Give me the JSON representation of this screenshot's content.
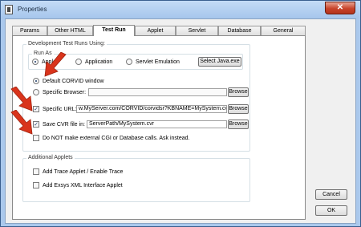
{
  "window": {
    "title": "Properties",
    "close_glyph": "✕"
  },
  "tabs": [
    "Params",
    "Other HTML",
    "Test Run",
    "Applet",
    "Servlet",
    "Database",
    "General"
  ],
  "active_tab": "Test Run",
  "dev_group": {
    "title": "Development Test Runs Using:"
  },
  "run_as": {
    "title": "Run As",
    "applet": "Applet",
    "application": "Application",
    "servlet": "Servlet Emulation",
    "select_java": "Select Java.exe"
  },
  "default_corvid": "Default CORVID window",
  "specific_browser": {
    "label": "Specific Browser:",
    "browse": "Browse"
  },
  "specific_url": {
    "label": "Specific URL:",
    "value": "w.MyServer.com/CORVID/corvidsr?KBNAME=MySystem.cvr",
    "browse": "Browse"
  },
  "save_cvr": {
    "label": "Save CVR file in:",
    "value": "ServerPath/MySystem.cvr",
    "browse": "Browse"
  },
  "do_not_make": "Do NOT make external CGI or Database calls.  Ask instead.",
  "additional": {
    "title": "Additional Applets",
    "trace": "Add Trace Applet / Enable Trace",
    "xml": "Add Exsys XML Interface Applet"
  },
  "buttons": {
    "cancel": "Cancel",
    "ok": "OK"
  },
  "check_mark": "✓",
  "accent_colors": {
    "arrow": "#d9341c",
    "title_bar": "#aac8ec",
    "close": "#c7432a"
  }
}
